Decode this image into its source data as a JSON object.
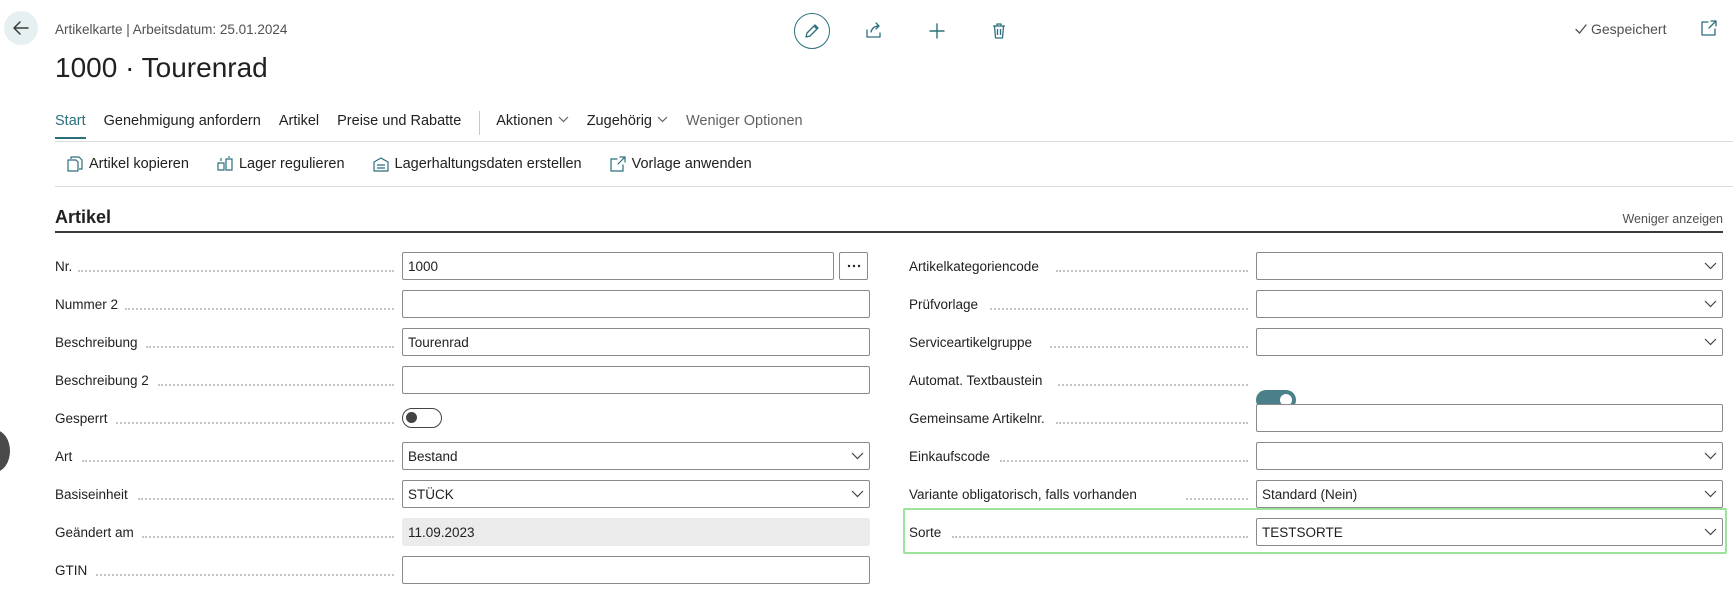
{
  "header": {
    "breadcrumb": "Artikelkarte | Arbeitsdatum: 25.01.2024",
    "title": "1000 · Tourenrad",
    "saved_label": "Gespeichert",
    "toolbar_icons": [
      "pencil-icon",
      "share-icon",
      "plus-icon",
      "trash-icon"
    ]
  },
  "tabs": [
    {
      "label": "Start",
      "active": true
    },
    {
      "label": "Genehmigung anfordern"
    },
    {
      "label": "Artikel"
    },
    {
      "label": "Preise und Rabatte"
    },
    {
      "label": "Aktionen",
      "dropdown": true
    },
    {
      "label": "Zugehörig",
      "dropdown": true
    },
    {
      "label": "Weniger Optionen"
    }
  ],
  "actions": [
    {
      "label": "Artikel kopieren",
      "icon": "copy-icon"
    },
    {
      "label": "Lager regulieren",
      "icon": "inventory-adjust-icon"
    },
    {
      "label": "Lagerhaltungsdaten erstellen",
      "icon": "warehouse-data-icon"
    },
    {
      "label": "Vorlage anwenden",
      "icon": "apply-template-icon"
    }
  ],
  "section": {
    "title": "Artikel",
    "toggle_label": "Weniger anzeigen"
  },
  "left_fields": [
    {
      "label": "Nr.",
      "value": "1000",
      "type": "text-with-lookup"
    },
    {
      "label": "Nummer 2",
      "value": "",
      "type": "text"
    },
    {
      "label": "Beschreibung",
      "value": "Tourenrad",
      "type": "text"
    },
    {
      "label": "Beschreibung 2",
      "value": "",
      "type": "text"
    },
    {
      "label": "Gesperrt",
      "value": false,
      "type": "toggle"
    },
    {
      "label": "Art",
      "value": "Bestand",
      "type": "select"
    },
    {
      "label": "Basiseinheit",
      "value": "STÜCK",
      "type": "select"
    },
    {
      "label": "Geändert am",
      "value": "11.09.2023",
      "type": "readonly"
    },
    {
      "label": "GTIN",
      "value": "",
      "type": "text"
    }
  ],
  "right_fields": [
    {
      "label": "Artikelkategoriencode",
      "value": "",
      "type": "select"
    },
    {
      "label": "Prüfvorlage",
      "value": "",
      "type": "select"
    },
    {
      "label": "Serviceartikelgruppe",
      "value": "",
      "type": "select"
    },
    {
      "label": "Automat. Textbaustein",
      "value": true,
      "type": "toggle"
    },
    {
      "label": "Gemeinsame Artikelnr.",
      "value": "",
      "type": "text"
    },
    {
      "label": "Einkaufscode",
      "value": "",
      "type": "select"
    },
    {
      "label": "Variante obligatorisch, falls vorhanden",
      "value": "Standard (Nein)",
      "type": "select"
    },
    {
      "label": "Sorte",
      "value": "TESTSORTE",
      "type": "select",
      "highlighted": true
    }
  ],
  "colors": {
    "accent": "#2b6f7c",
    "toggle_on": "#49808a",
    "highlight": "#9ee39c"
  }
}
